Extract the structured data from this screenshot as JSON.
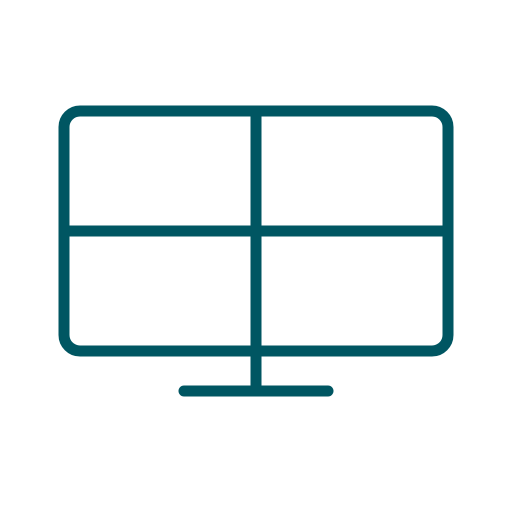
{
  "icon": {
    "name": "monitor-grid-icon",
    "stroke_color": "#005662",
    "background_color": "#ffffff"
  }
}
